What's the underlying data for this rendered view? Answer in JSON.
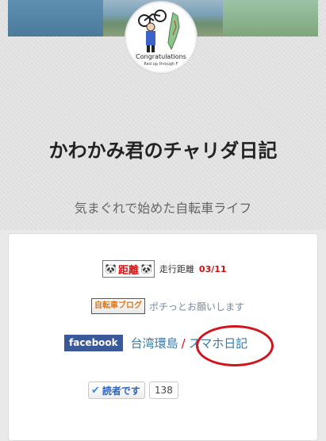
{
  "header": {
    "title": "かわかみ君のチャリダ日記",
    "description": "気まぐれで始めた自転車ライフ",
    "avatar_text_main": "Congratulations",
    "avatar_text_sub": "Red up through F"
  },
  "widgets": {
    "distance_badge_text": "距離",
    "distance_label": "走行距離",
    "distance_value": "03/11",
    "blog_ranking_badge": "自転車ブログ",
    "vote_text": "ポチっとお願いします",
    "facebook_label": "facebook",
    "link_taiwan": "台湾環島",
    "link_separator": "/",
    "link_smartphone": "スマホ日記",
    "subscribe_label": "読者です",
    "subscriber_count": "138"
  },
  "colors": {
    "facebook": "#3b5998",
    "link": "#3a79a8",
    "highlight_oval": "#d0141e",
    "distance_value": "#d01010"
  }
}
